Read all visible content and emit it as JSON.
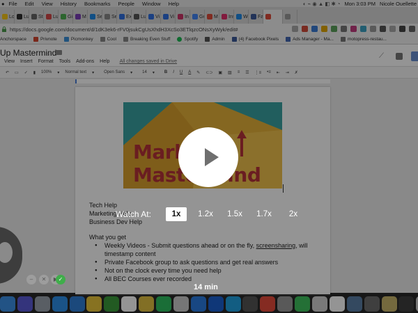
{
  "menubar": {
    "items": [
      "File",
      "Edit",
      "View",
      "History",
      "Bookmarks",
      "People",
      "Window",
      "Help"
    ],
    "clock": "Mon 3:03 PM",
    "user": "Nicole Ouellette"
  },
  "tabs": [
    {
      "label": "Lo",
      "color": "#f5c518"
    },
    {
      "label": "Lu",
      "color": "#2e2e2e"
    },
    {
      "label": "St",
      "color": "#666666"
    },
    {
      "label": "Lu",
      "color": "#d24747"
    },
    {
      "label": "Gi",
      "color": "#4caf50"
    },
    {
      "label": "M",
      "color": "#7a3fb8"
    },
    {
      "label": "Se",
      "color": "#1e88e5"
    },
    {
      "label": "Se",
      "color": "#888888"
    },
    {
      "label": "Ex",
      "color": "#2f6fe0"
    },
    {
      "label": "Lu",
      "color": "#555555"
    },
    {
      "label": "Vi",
      "color": "#2f6fe0"
    },
    {
      "label": "Vi",
      "color": "#2f6fe0"
    },
    {
      "label": "In",
      "color": "#cc3366"
    },
    {
      "label": "Ge",
      "color": "#4285f4"
    },
    {
      "label": "M",
      "color": "#dd4b39"
    },
    {
      "label": "Ins",
      "color": "#e1306c"
    },
    {
      "label": "Wo",
      "color": "#1e88e5"
    },
    {
      "label": "Fa",
      "color": "#3b5998"
    },
    {
      "label": "",
      "color": "#dd4b39",
      "active": true
    },
    {
      "label": "",
      "color": "#999999"
    }
  ],
  "address": {
    "url": "https://docs.google.com/document/d/1dK3ek6-rFV0jsukCgUsXhdH3XcSo3ETlqzcONsXyWyk/edit#"
  },
  "bookmarks": [
    "Anchorspace",
    "Privnote",
    "Picmonkey",
    "Cool",
    "Breaking Even Stuff",
    "Spotify",
    "Admin",
    "(4) Facebook Pixels",
    "Ads Manager - Ma...",
    "motopress-restau..."
  ],
  "docs": {
    "title": "Up Mastermind",
    "menu": [
      "View",
      "Insert",
      "Format",
      "Tools",
      "Add-ons",
      "Help"
    ],
    "saved": "All changes saved in Drive",
    "toolbar": {
      "zoom": "100%",
      "style": "Normal text",
      "font": "Open Sans",
      "size": "14",
      "bold": "B",
      "italic": "I",
      "underline": "U",
      "textcolor": "A"
    },
    "logo": {
      "line1": "Mark  Up",
      "line2": "Mastermind"
    },
    "content": {
      "line1": "Tech Help",
      "line2": "Marketing Help",
      "line3": "Business Dev Help",
      "what_you_get": "What you get",
      "bullet1": "Weekly Videos - Submit questions ahead or on the fly, ",
      "bullet1_link": "screensharing",
      "bullet1_end": ", will",
      "bullet1_cont": "timestamp content",
      "bullet2": "Private Facebook group to ask questions and get real answers",
      "bullet3": "Not on the clock every time you need help",
      "bullet4": "All BEC Courses ever recorded"
    }
  },
  "player": {
    "watch_at": "Watch At:",
    "speeds": [
      "1x",
      "1.2x",
      "1.5x",
      "1.7x",
      "2x"
    ],
    "selected_speed": "1x",
    "duration": "14 min"
  },
  "dock": {
    "apps": [
      {
        "icon": "finder-icon",
        "color": "#3b8fe6"
      },
      {
        "icon": "siri-icon",
        "color": "#5b5bd6"
      },
      {
        "icon": "launchpad-icon",
        "color": "#9aa3ad"
      },
      {
        "icon": "app-store-icon",
        "color": "#2e8fe8"
      },
      {
        "icon": "safari-icon",
        "color": "#2f7fd6"
      },
      {
        "icon": "notes-icon",
        "color": "#e8c53a"
      },
      {
        "icon": "tools-icon",
        "color": "#3c9c3c"
      },
      {
        "icon": "photos-icon",
        "color": "#ffffff"
      },
      {
        "icon": "chrome-icon",
        "color": "#e0c040"
      },
      {
        "icon": "evernote-icon",
        "color": "#2dbe60"
      },
      {
        "icon": "generic-app-icon",
        "color": "#cccccc"
      },
      {
        "icon": "generic-app-icon",
        "color": "#2a7be0"
      },
      {
        "icon": "generic-app-icon",
        "color": "#1b5fcf"
      },
      {
        "icon": "skype-icon",
        "color": "#1fa0e0"
      },
      {
        "icon": "terminal-icon",
        "color": "#555555"
      },
      {
        "icon": "calendar-icon",
        "color": "#e54b3c"
      },
      {
        "icon": "screen-icon",
        "color": "#9a9a9a"
      },
      {
        "icon": "messages-icon",
        "color": "#3ec15e"
      },
      {
        "icon": "screen-icon",
        "color": "#d0d0d0"
      },
      {
        "icon": "window-icon",
        "color": "#ffffff"
      },
      {
        "icon": "window-icon",
        "color": "#5a7fa6"
      },
      {
        "icon": "window-icon",
        "color": "#6d6d6d"
      },
      {
        "icon": "window-icon",
        "color": "#c8b56b"
      },
      {
        "icon": "window-icon",
        "color": "#3e3e3e"
      },
      {
        "icon": "window-icon",
        "color": "#cfcfcf"
      },
      {
        "icon": "window-icon",
        "color": "#8f8f8f"
      },
      {
        "icon": "window-icon",
        "color": "#d6d6d6"
      },
      {
        "icon": "window-icon",
        "color": "#bdbdbd"
      }
    ]
  }
}
